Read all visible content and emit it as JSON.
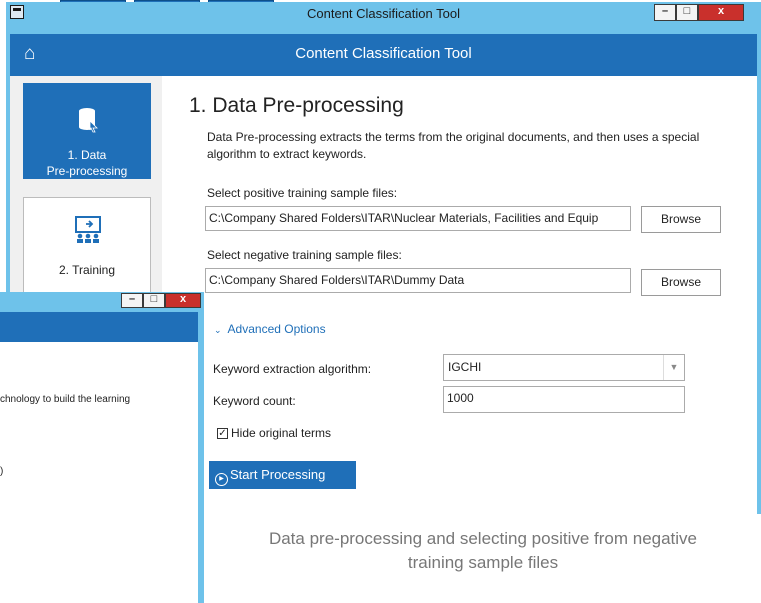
{
  "window": {
    "title": "Content Classification Tool",
    "minimize": "–",
    "maximize": "□",
    "close": "x"
  },
  "header": {
    "title": "Content Classification Tool"
  },
  "sidebar": {
    "items": [
      {
        "label_line1": "1. Data",
        "label_line2": "Pre-processing",
        "active": true,
        "icon": "database-icon"
      },
      {
        "label_line1": "2. Training",
        "label_line2": "",
        "active": false,
        "icon": "presentation-icon"
      }
    ]
  },
  "main": {
    "section_title": "1. Data Pre-processing",
    "description": "Data Pre-processing extracts the terms from the original documents, and then uses a special algorithm to extract keywords.",
    "positive_label": "Select positive training sample files:",
    "positive_value": "C:\\Company Shared Folders\\ITAR\\Nuclear Materials, Facilities and Equip",
    "negative_label": "Select negative training sample files:",
    "negative_value": "C:\\Company Shared Folders\\ITAR\\Dummy Data",
    "browse_label": "Browse",
    "advanced_label": "Advanced Options",
    "algorithm_label": "Keyword extraction algorithm:",
    "algorithm_value": "IGCHI",
    "count_label": "Keyword count:",
    "count_value": "1000",
    "hide_terms_label": "Hide original terms",
    "hide_terms_checked": true,
    "start_label": "Start Processing"
  },
  "second_window": {
    "text_fragment": "chnology to build the learning",
    "fragment_2": ")"
  },
  "caption": {
    "line1": "Data pre-processing and selecting positive from negative",
    "line2": "training sample files"
  },
  "colors": {
    "accent": "#1f6fb8",
    "titlebar": "#6ec2ea",
    "close": "#c9302c"
  }
}
